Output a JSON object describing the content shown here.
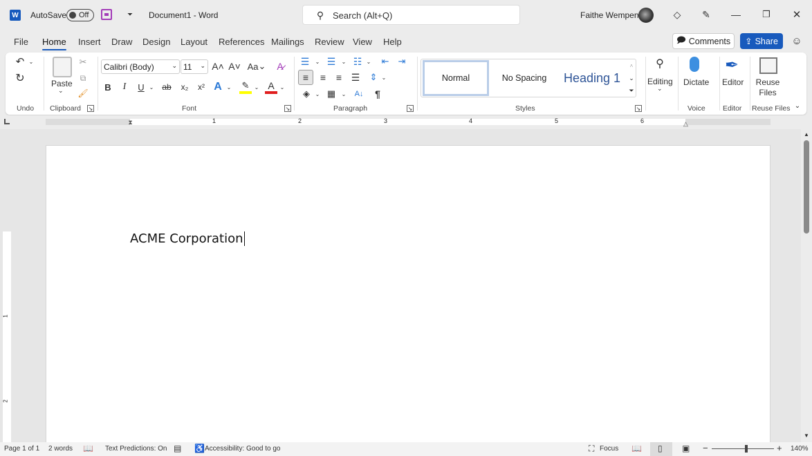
{
  "titlebar": {
    "autosave_label": "AutoSave",
    "autosave_state": "Off",
    "doc_title": "Document1  -  Word",
    "search_placeholder": "Search (Alt+Q)",
    "user_name": "Faithe Wempen"
  },
  "tabs": [
    {
      "label": "File"
    },
    {
      "label": "Home",
      "active": true
    },
    {
      "label": "Insert"
    },
    {
      "label": "Draw"
    },
    {
      "label": "Design"
    },
    {
      "label": "Layout"
    },
    {
      "label": "References"
    },
    {
      "label": "Mailings"
    },
    {
      "label": "Review"
    },
    {
      "label": "View"
    },
    {
      "label": "Help"
    }
  ],
  "actions": {
    "comments": "Comments",
    "share": "Share"
  },
  "ribbon": {
    "groups": {
      "undo": "Undo",
      "clipboard": "Clipboard",
      "font": "Font",
      "paragraph": "Paragraph",
      "styles": "Styles",
      "voice": "Voice",
      "editor": "Editor",
      "reuse": "Reuse Files"
    },
    "paste": "Paste",
    "font_name": "Calibri (Body)",
    "font_size": "11",
    "change_case": "Aa",
    "styles": [
      "Normal",
      "No Spacing",
      "Heading 1"
    ],
    "editing": "Editing",
    "dictate": "Dictate",
    "editor": "Editor",
    "reuse_files": "Reuse Files"
  },
  "colors": {
    "accent": "#185abd",
    "highlight": "#ffff00",
    "font_color": "#e01e1e"
  },
  "ruler": {
    "numbers": [
      "1",
      "2",
      "3",
      "4",
      "5",
      "6"
    ],
    "vnumbers": [
      "1",
      "2"
    ]
  },
  "document": {
    "text": "ACME Corporation"
  },
  "status": {
    "page": "Page 1 of 1",
    "words": "2 words",
    "predictions": "Text Predictions: On",
    "accessibility": "Accessibility: Good to go",
    "focus": "Focus",
    "zoom": "140%",
    "zoom_percent": 140
  }
}
